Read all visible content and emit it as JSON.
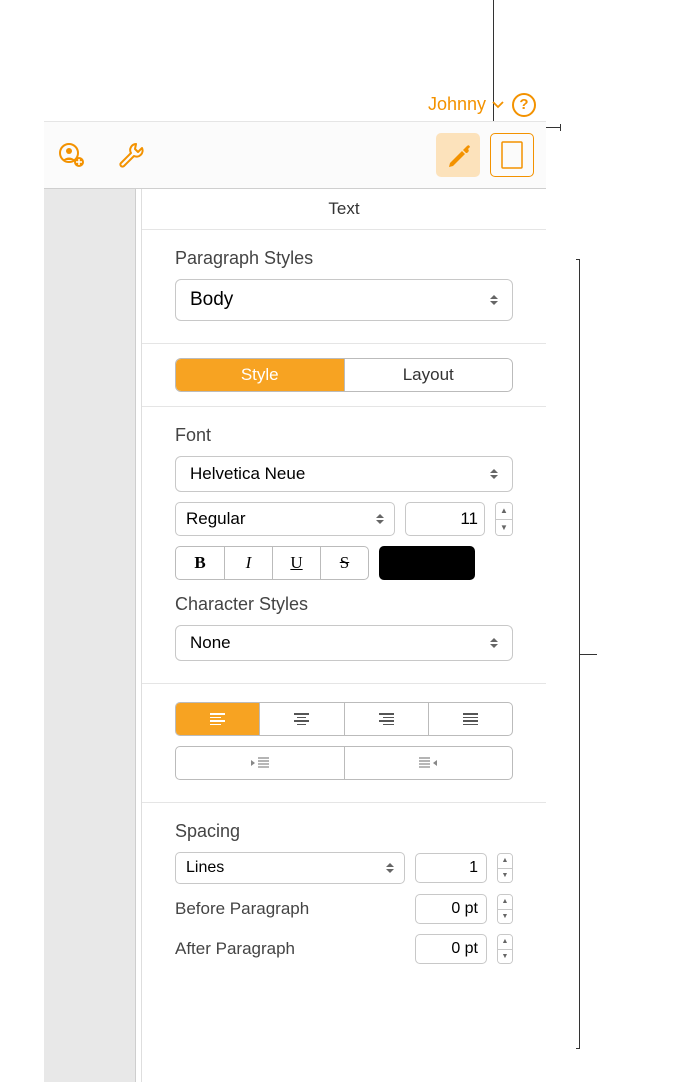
{
  "header": {
    "user_name": "Johnny"
  },
  "inspector": {
    "title": "Text",
    "paragraph_styles": {
      "label": "Paragraph Styles",
      "value": "Body"
    },
    "tabs": {
      "style": "Style",
      "layout": "Layout"
    },
    "font": {
      "label": "Font",
      "family": "Helvetica Neue",
      "weight": "Regular",
      "size": "11",
      "bold": "B",
      "italic": "I",
      "underline": "U",
      "strike": "S"
    },
    "character_styles": {
      "label": "Character Styles",
      "value": "None"
    },
    "spacing": {
      "label": "Spacing",
      "mode": "Lines",
      "value": "1",
      "before_label": "Before Paragraph",
      "before_value": "0 pt",
      "after_label": "After Paragraph",
      "after_value": "0 pt"
    }
  }
}
